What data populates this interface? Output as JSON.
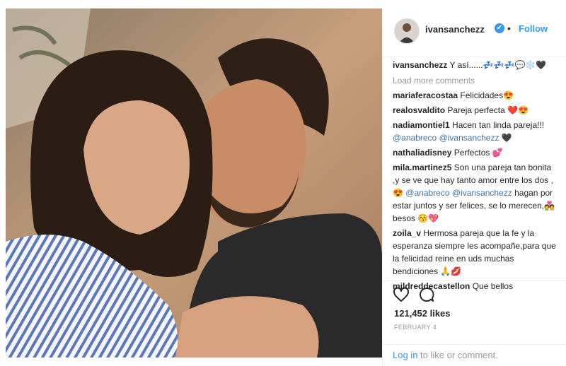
{
  "colors": {
    "accent": "#3897f0",
    "mention": "#3f72af",
    "muted": "#999999",
    "text": "#262626"
  },
  "header": {
    "username": "ivansanchezz",
    "separator": "•",
    "follow_label": "Follow",
    "verified_icon": "verified-badge-icon",
    "verified_glyph": "✔"
  },
  "caption": {
    "username": "ivansanchezz",
    "text": "Y así......💤💤💤💬❄️🖤"
  },
  "load_more": "Load more comments",
  "comments": [
    {
      "user": "mariaferacostaa",
      "text": "Felicidades😍"
    },
    {
      "user": "realosvaldito",
      "text": "Pareja perfecta ❤️😍"
    },
    {
      "user": "nadiamontiel1",
      "text": "Hacen tan linda pareja!!!",
      "mention1": "@anabreco",
      "mention2": "@ivansanchezz",
      "tail": "🖤"
    },
    {
      "user": "nathaliadisney",
      "text": "Perfectos 💕"
    },
    {
      "user": "mila.martinez5",
      "text": "Son una pareja tan bonita ,y se ve que hay tanto amor entre los dos ,😍",
      "mention1": "@anabreco",
      "mention2": "@ivansanchezz",
      "tail": "hagan por estar juntos y ser felices, se lo merecen,💑 besos 😚💖"
    },
    {
      "user": "zoila_v",
      "text": "Hermosa pareja que la fe y la esperanza siempre les acompañe,para que la felicidad reine en uds muchas bendiciones 🙏💋"
    },
    {
      "user": "mildreddecastellon",
      "text": "Que bellos"
    }
  ],
  "actions": {
    "like_icon": "heart-icon",
    "comment_icon": "comment-icon"
  },
  "likes": "121,452 likes",
  "date": "FEBRUARY 4",
  "login": {
    "link": "Log in",
    "rest": " to like or comment."
  }
}
